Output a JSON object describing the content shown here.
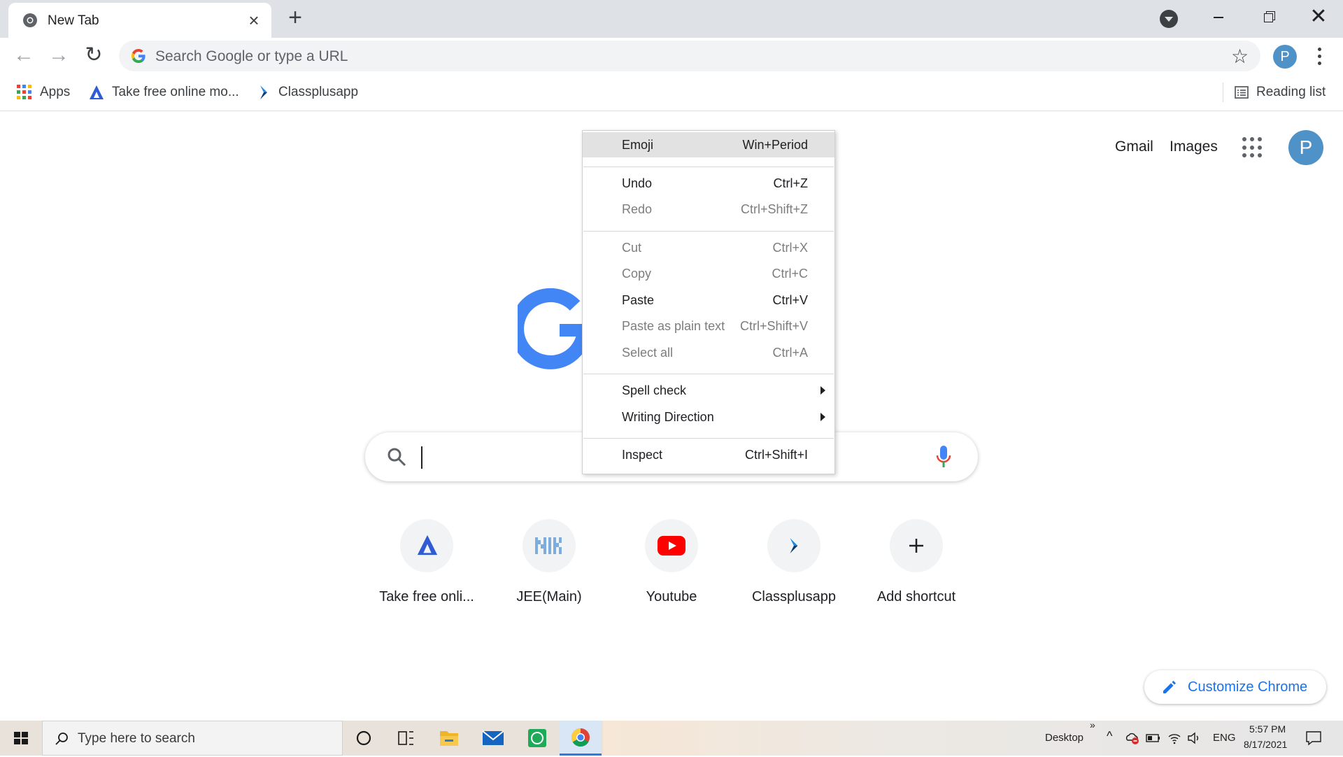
{
  "tab": {
    "title": "New Tab"
  },
  "omnibox": {
    "placeholder": "Search Google or type a URL"
  },
  "profile": {
    "initial": "P"
  },
  "bookmarks": [
    {
      "label": "Apps"
    },
    {
      "label": "Take free online mo..."
    },
    {
      "label": "Classplusapp"
    }
  ],
  "reading_list": {
    "label": "Reading list"
  },
  "ntp": {
    "gmail": "Gmail",
    "images": "Images",
    "avatar_initial": "P",
    "shortcuts": [
      {
        "label": "Take free onli...",
        "icon": "unacademy-icon"
      },
      {
        "label": "JEE(Main)",
        "icon": "nic-icon"
      },
      {
        "label": "Youtube",
        "icon": "youtube-icon"
      },
      {
        "label": "Classplusapp",
        "icon": "classplus-icon"
      },
      {
        "label": "Add shortcut",
        "icon": "plus-icon"
      }
    ],
    "customize": "Customize Chrome"
  },
  "context_menu": {
    "items": [
      {
        "label": "Emoji",
        "shortcut": "Win+Period",
        "enabled": true,
        "highlight": true
      },
      {
        "label": "Undo",
        "shortcut": "Ctrl+Z",
        "enabled": true
      },
      {
        "label": "Redo",
        "shortcut": "Ctrl+Shift+Z",
        "enabled": false
      },
      {
        "label": "Cut",
        "shortcut": "Ctrl+X",
        "enabled": false
      },
      {
        "label": "Copy",
        "shortcut": "Ctrl+C",
        "enabled": false
      },
      {
        "label": "Paste",
        "shortcut": "Ctrl+V",
        "enabled": true
      },
      {
        "label": "Paste as plain text",
        "shortcut": "Ctrl+Shift+V",
        "enabled": false
      },
      {
        "label": "Select all",
        "shortcut": "Ctrl+A",
        "enabled": false
      },
      {
        "label": "Spell check",
        "shortcut": "",
        "enabled": true,
        "submenu": true
      },
      {
        "label": "Writing Direction",
        "shortcut": "",
        "enabled": true,
        "submenu": true
      },
      {
        "label": "Inspect",
        "shortcut": "Ctrl+Shift+I",
        "enabled": true
      }
    ]
  },
  "taskbar": {
    "search_placeholder": "Type here to search",
    "desktop_label": "Desktop",
    "language": "ENG",
    "time": "5:57 PM",
    "date": "8/17/2021"
  },
  "colors": {
    "accent": "#1a73e8",
    "google_blue": "#4285f4",
    "avatar": "#4f92c8",
    "tabstrip": "#dee1e6"
  }
}
